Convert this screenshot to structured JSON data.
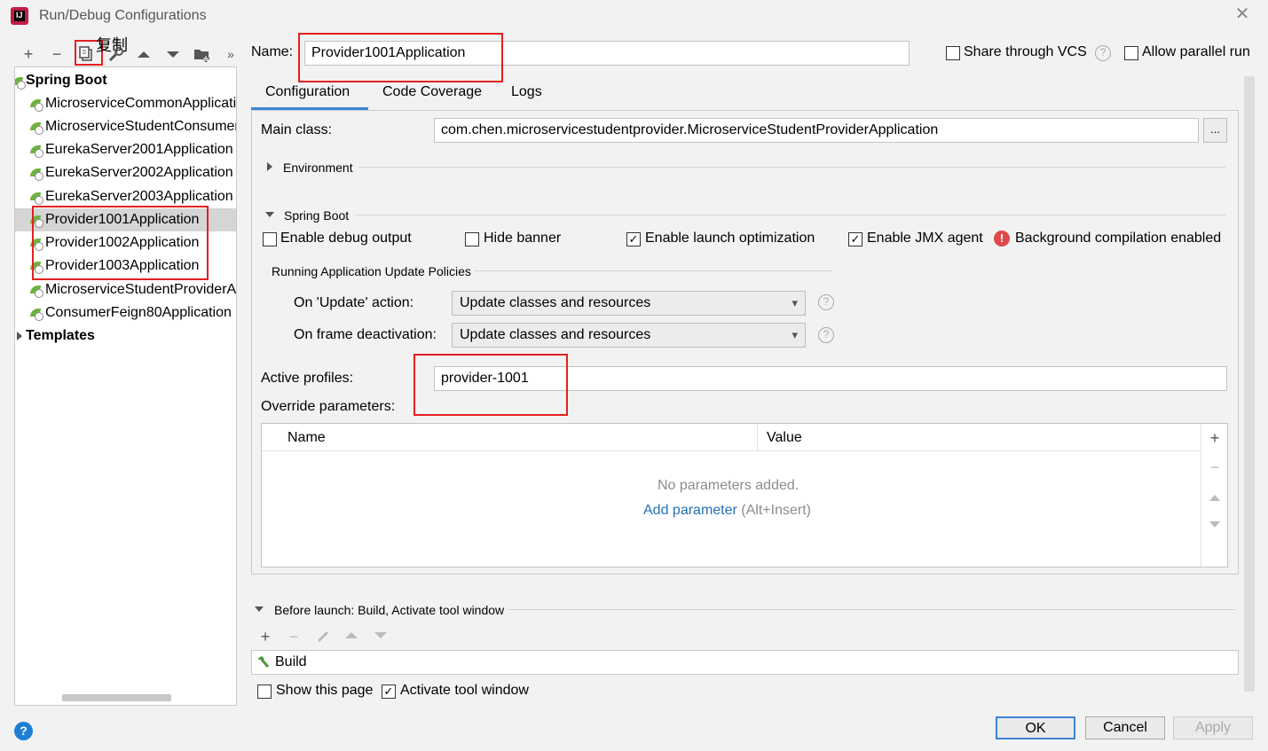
{
  "window": {
    "title": "Run/Debug Configurations",
    "app_icon_text": "IJ",
    "close_glyph": "✕"
  },
  "toolbar": {
    "copy_annotation": "复制",
    "icons": [
      "plus-icon",
      "minus-icon",
      "copy-icon",
      "wrench-icon",
      "arrow-up-icon",
      "arrow-down-icon",
      "folder-add-icon",
      "more-icon"
    ]
  },
  "tree": {
    "group_spring": "Spring Boot",
    "items": [
      "MicroserviceCommonApplication",
      "MicroserviceStudentConsumerApplication",
      "EurekaServer2001Application",
      "EurekaServer2002Application",
      "EurekaServer2003Application",
      "Provider1001Application",
      "Provider1002Application",
      "Provider1003Application",
      "MicroserviceStudentProviderApplication",
      "ConsumerFeign80Application"
    ],
    "selected": "Provider1001Application",
    "group_templates": "Templates"
  },
  "header": {
    "name_label": "Name:",
    "name_value": "Provider1001Application",
    "share_vcs": "Share through VCS",
    "share_vcs_checked": false,
    "allow_parallel": "Allow parallel run",
    "allow_parallel_checked": false
  },
  "tabs": [
    "Configuration",
    "Code Coverage",
    "Logs"
  ],
  "active_tab": "Configuration",
  "config": {
    "main_class_label": "Main class:",
    "main_class_value": "com.chen.microservicestudentprovider.MicroserviceStudentProviderApplication",
    "browse_button": "...",
    "environment_label": "Environment",
    "spring_boot_label": "Spring Boot",
    "enable_debug": "Enable debug output",
    "enable_debug_checked": false,
    "hide_banner": "Hide banner",
    "hide_banner_checked": false,
    "launch_opt": "Enable launch optimization",
    "launch_opt_checked": true,
    "jmx_agent": "Enable JMX agent",
    "jmx_agent_checked": true,
    "bg_compile": "Background compilation enabled",
    "policies_label": "Running Application Update Policies",
    "on_update_label": "On 'Update' action:",
    "on_update_value": "Update classes and resources",
    "on_frame_label": "On frame deactivation:",
    "on_frame_value": "Update classes and resources",
    "active_profiles_label": "Active profiles:",
    "active_profiles_value": "provider-1001",
    "override_label": "Override parameters:",
    "col_name": "Name",
    "col_value": "Value",
    "no_params": "No parameters added.",
    "add_param": "Add parameter",
    "add_param_shortcut": "(Alt+Insert)"
  },
  "before_launch": {
    "label": "Before launch: Build, Activate tool window",
    "task": "Build",
    "show_page": "Show this page",
    "show_page_checked": false,
    "activate_tool": "Activate tool window",
    "activate_tool_checked": true
  },
  "buttons": {
    "ok": "OK",
    "cancel": "Cancel",
    "apply": "Apply",
    "help": "?"
  },
  "colors": {
    "accent": "#3c84d8",
    "highlight_box": "#e32020",
    "link": "#2470b3"
  }
}
